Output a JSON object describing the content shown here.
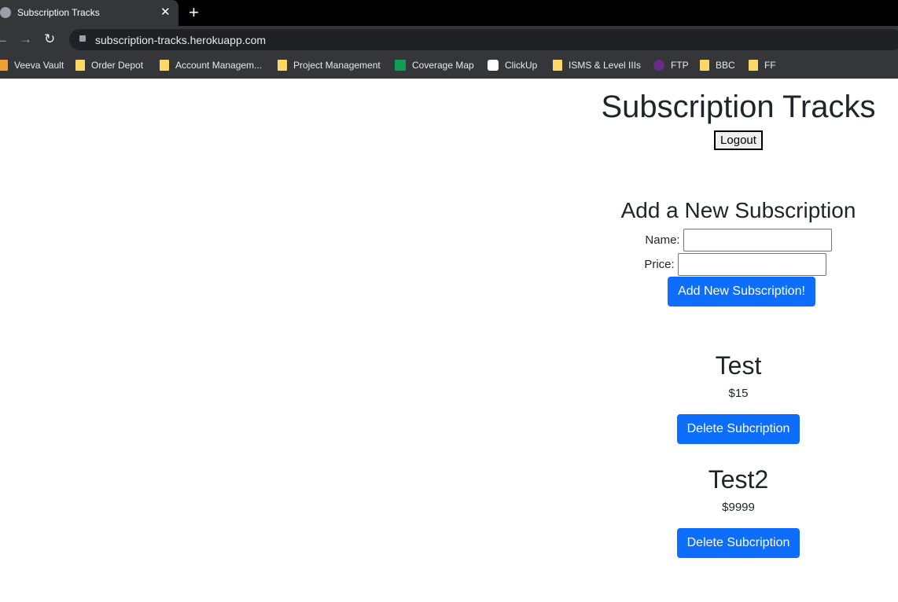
{
  "browser": {
    "tab_title": "Subscription Tracks",
    "url": "subscription-tracks.herokuapp.com",
    "bookmarks": [
      "Veeva Vault",
      "Order Depot",
      "Account Managem...",
      "Project Management",
      "Coverage Map",
      "ClickUp",
      "ISMS & Level IIIs",
      "FTP",
      "BBC",
      "FF"
    ]
  },
  "page": {
    "title": "Subscription Tracks",
    "logout_label": "Logout",
    "form": {
      "heading": "Add a New Subscription",
      "name_label": "Name:",
      "name_value": "",
      "price_label": "Price:",
      "price_value": "",
      "submit_label": "Add New Subscription!"
    },
    "subscriptions": [
      {
        "name": "Test",
        "price": "$15",
        "delete_label": "Delete Subcription"
      },
      {
        "name": "Test2",
        "price": "$9999",
        "delete_label": "Delete Subcription"
      }
    ]
  },
  "colors": {
    "primary": "#0d6efd",
    "chrome": "#35363a"
  }
}
